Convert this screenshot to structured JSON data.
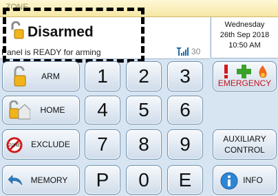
{
  "zone_bar": {
    "label": "ZONE"
  },
  "status": {
    "title": "Disarmed",
    "message": "Panel is READY for arming",
    "signal_value": "30",
    "signal_icon": "signal-bars-icon"
  },
  "datetime": {
    "day": "Wednesday",
    "date": "26th Sep 2018",
    "time": "10:50 AM"
  },
  "actions": {
    "arm": "ARM",
    "home": "HOME",
    "exclude": "EXCLUDE",
    "memory": "MEMORY",
    "emergency": "EMERGENCY",
    "auxiliary_line1": "AUXILIARY",
    "auxiliary_line2": "CONTROL",
    "info": "INFO"
  },
  "keypad": {
    "k1": "1",
    "k2": "2",
    "k3": "3",
    "k4": "4",
    "k5": "5",
    "k6": "6",
    "k7": "7",
    "k8": "8",
    "k9": "9",
    "kP": "P",
    "k0": "0",
    "kE": "E"
  },
  "icons": {
    "exclude_badge": "ZONE"
  },
  "colors": {
    "header_bg": "#f5e7a3",
    "panel_bg": "#d7e5f2",
    "emergency_text": "#c0141c",
    "button_border": "#6f8eac"
  }
}
